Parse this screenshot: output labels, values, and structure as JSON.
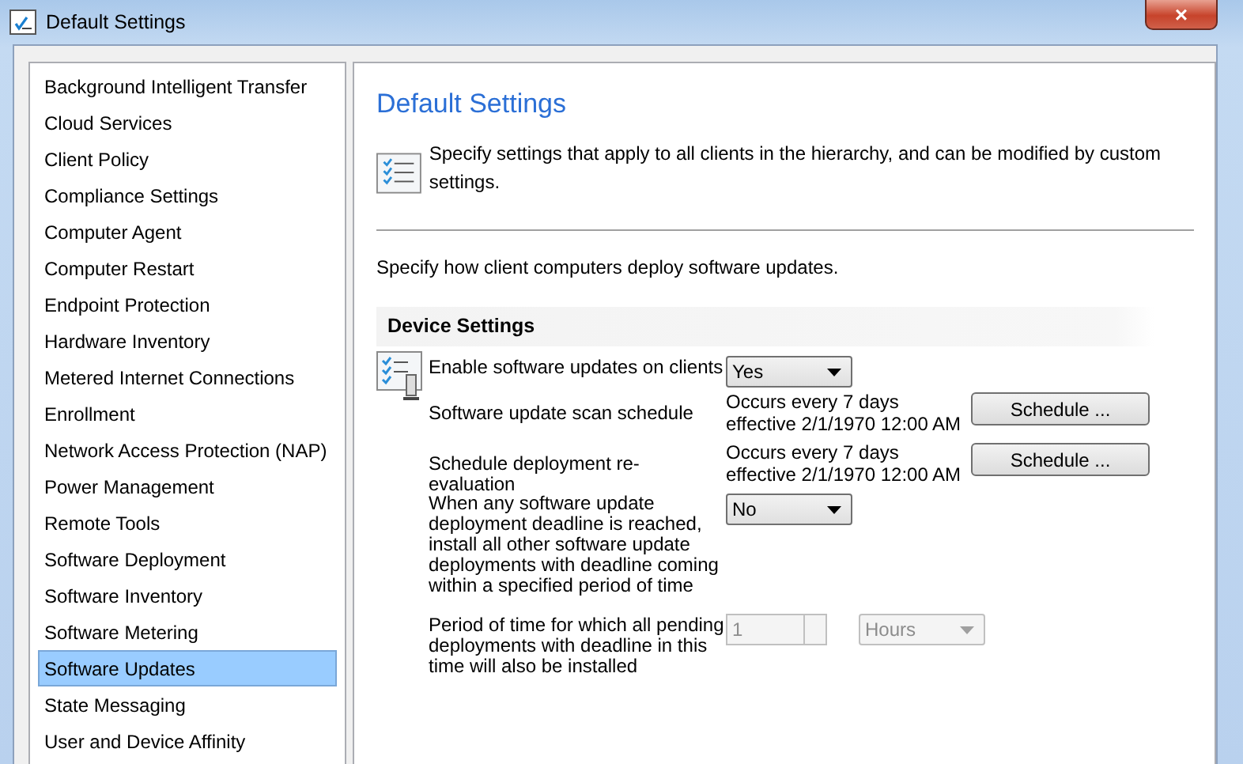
{
  "window": {
    "title": "Default Settings",
    "close": "×"
  },
  "sidebar": {
    "items": [
      {
        "label": "Background Intelligent Transfer",
        "selected": false
      },
      {
        "label": "Cloud Services",
        "selected": false
      },
      {
        "label": "Client Policy",
        "selected": false
      },
      {
        "label": "Compliance Settings",
        "selected": false
      },
      {
        "label": "Computer Agent",
        "selected": false
      },
      {
        "label": "Computer Restart",
        "selected": false
      },
      {
        "label": "Endpoint Protection",
        "selected": false
      },
      {
        "label": "Hardware Inventory",
        "selected": false
      },
      {
        "label": "Metered Internet Connections",
        "selected": false
      },
      {
        "label": "Enrollment",
        "selected": false
      },
      {
        "label": "Network Access Protection (NAP)",
        "selected": false
      },
      {
        "label": "Power Management",
        "selected": false
      },
      {
        "label": "Remote Tools",
        "selected": false
      },
      {
        "label": "Software Deployment",
        "selected": false
      },
      {
        "label": "Software Inventory",
        "selected": false
      },
      {
        "label": "Software Metering",
        "selected": false
      },
      {
        "label": "Software Updates",
        "selected": true
      },
      {
        "label": "State Messaging",
        "selected": false
      },
      {
        "label": "User and Device Affinity",
        "selected": false
      }
    ]
  },
  "content": {
    "heading": "Default Settings",
    "intro": "Specify settings that apply to all clients in the hierarchy, and can be modified by custom settings.",
    "description": "Specify how client computers deploy software updates.",
    "section_title": "Device Settings",
    "settings": [
      {
        "kind": "select",
        "label": "Enable software updates on clients",
        "value": "Yes",
        "disabled": false
      },
      {
        "kind": "schedule",
        "label": "Software update scan schedule",
        "value": "Occurs every 7 days effective 2/1/1970 12:00 AM",
        "button": "Schedule ..."
      },
      {
        "kind": "schedule",
        "label": "Schedule deployment re-evaluation",
        "value": "Occurs every 7 days effective 2/1/1970 12:00 AM",
        "button": "Schedule ..."
      },
      {
        "kind": "select",
        "label": "When any software update deployment deadline is reached, install all other software update deployments with deadline coming within a specified period of time",
        "value": "No",
        "disabled": false
      },
      {
        "kind": "spinner",
        "label": "Period of time for which all pending deployments with deadline in this time will also be installed",
        "value": "1",
        "unit": "Hours",
        "disabled": true
      }
    ]
  }
}
